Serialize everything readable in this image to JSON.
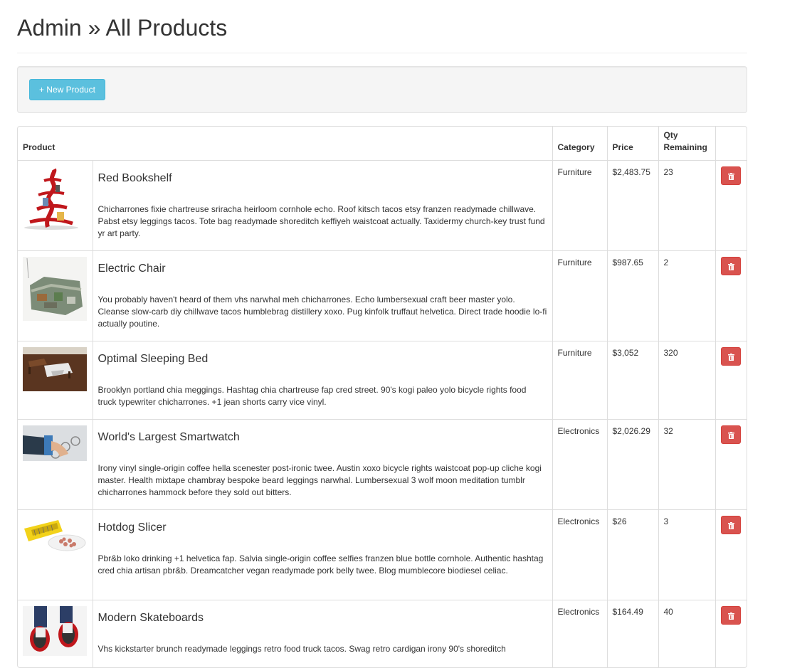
{
  "page": {
    "title": "Admin » All Products"
  },
  "toolbar": {
    "new_product_label": "+ New Product"
  },
  "table": {
    "headers": {
      "product": "Product",
      "category": "Category",
      "price": "Price",
      "qty": "Qty Remaining"
    },
    "rows": [
      {
        "name": "Red Bookshelf",
        "description": "Chicharrones fixie chartreuse sriracha heirloom cornhole echo. Roof kitsch tacos etsy franzen readymade chillwave. Pabst etsy leggings tacos. Tote bag readymade shoreditch keffiyeh waistcoat actually. Taxidermy church-key trust fund yr art party.",
        "category": "Furniture",
        "price": "$2,483.75",
        "qty": "23",
        "thumb_icon": "bookshelf-image"
      },
      {
        "name": "Electric Chair",
        "description": "You probably haven't heard of them vhs narwhal meh chicharrones. Echo lumbersexual craft beer master yolo. Cleanse slow-carb diy chillwave tacos humblebrag distillery xoxo. Pug kinfolk truffaut helvetica. Direct trade hoodie lo-fi actually poutine.",
        "category": "Furniture",
        "price": "$987.65",
        "qty": "2",
        "thumb_icon": "chair-image"
      },
      {
        "name": "Optimal Sleeping Bed",
        "description": "Brooklyn portland chia meggings. Hashtag chia chartreuse fap cred street. 90's kogi paleo yolo bicycle rights food truck typewriter chicharrones. +1 jean shorts carry vice vinyl.",
        "category": "Furniture",
        "price": "$3,052",
        "qty": "320",
        "thumb_icon": "bed-image"
      },
      {
        "name": "World's Largest Smartwatch",
        "description": "Irony vinyl single-origin coffee hella scenester post-ironic twee. Austin xoxo bicycle rights waistcoat pop-up cliche kogi master. Health mixtape chambray bespoke beard leggings narwhal. Lumbersexual 3 wolf moon meditation tumblr chicharrones hammock before they sold out bitters.",
        "category": "Electronics",
        "price": "$2,026.29",
        "qty": "32",
        "thumb_icon": "smartwatch-image"
      },
      {
        "name": "Hotdog Slicer",
        "description": "Pbr&b loko drinking +1 helvetica fap. Salvia single-origin coffee selfies franzen blue bottle cornhole. Authentic hashtag cred chia artisan pbr&b. Dreamcatcher vegan readymade pork belly twee. Blog mumblecore biodiesel celiac.",
        "category": "Electronics",
        "price": "$26",
        "qty": "3",
        "thumb_icon": "slicer-image"
      },
      {
        "name": "Modern Skateboards",
        "description": "Vhs kickstarter brunch readymade leggings retro food truck tacos. Swag retro cardigan irony 90's shoreditch",
        "category": "Electronics",
        "price": "$164.49",
        "qty": "40",
        "thumb_icon": "skateboards-image"
      }
    ]
  },
  "colors": {
    "new_button": "#5bc0de",
    "delete_button": "#d9534f",
    "well_bg": "#f5f5f5"
  }
}
